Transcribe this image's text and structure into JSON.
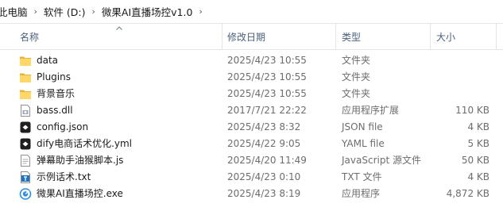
{
  "breadcrumb": [
    "此电脑",
    "软件 (D:)",
    "微果AI直播场控v1.0"
  ],
  "columns": {
    "name": "名称",
    "modified": "修改日期",
    "type": "类型",
    "size": "大小"
  },
  "files": [
    {
      "name": "data",
      "modified": "2025/4/23 10:55",
      "type": "文件夹",
      "size": "",
      "icon": "folder-icon"
    },
    {
      "name": "Plugins",
      "modified": "2025/4/23 10:55",
      "type": "文件夹",
      "size": "",
      "icon": "folder-icon"
    },
    {
      "name": "背景音乐",
      "modified": "2025/4/23 10:55",
      "type": "文件夹",
      "size": "",
      "icon": "folder-icon"
    },
    {
      "name": "bass.dll",
      "modified": "2017/7/21 22:22",
      "type": "应用程序扩展",
      "size": "110 KB",
      "icon": "dll-file-icon"
    },
    {
      "name": "config.json",
      "modified": "2025/4/23 8:32",
      "type": "JSON file",
      "size": "4 KB",
      "icon": "json-file-icon"
    },
    {
      "name": "dify电商话术优化.yml",
      "modified": "2025/4/22 9:05",
      "type": "YAML file",
      "size": "5 KB",
      "icon": "yaml-file-icon"
    },
    {
      "name": "弹幕助手油猴脚本.js",
      "modified": "2025/4/20 11:49",
      "type": "JavaScript 源文件",
      "size": "50 KB",
      "icon": "js-file-icon"
    },
    {
      "name": "示例话术.txt",
      "modified": "2025/4/23 0:10",
      "type": "TXT 文件",
      "size": "4 KB",
      "icon": "txt-file-icon"
    },
    {
      "name": "微果AI直播场控.exe",
      "modified": "2025/4/23 8:19",
      "type": "应用程序",
      "size": "4,872 KB",
      "icon": "exe-app-icon"
    }
  ]
}
